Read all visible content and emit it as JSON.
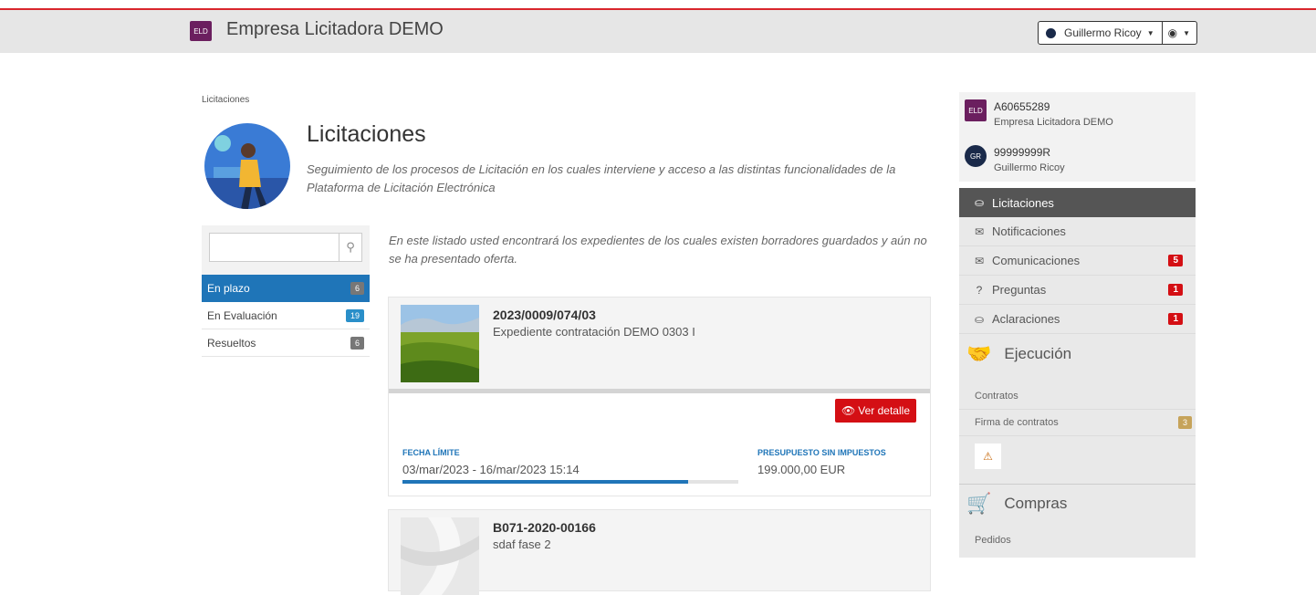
{
  "header": {
    "brand_badge": "ELD",
    "brand_name": "Empresa Licitadora DEMO",
    "user_name": "Guillermo Ricoy"
  },
  "breadcrumb": "Licitaciones",
  "page": {
    "title": "Licitaciones",
    "description": "Seguimiento de los procesos de Licitación en los cuales interviene y acceso a las distintas funcionalidades de la Plataforma de Licitación Electrónica"
  },
  "leftnav": {
    "search_placeholder": "",
    "items": [
      {
        "label": "En plazo",
        "count": "6"
      },
      {
        "label": "En Evaluación",
        "count": "19"
      },
      {
        "label": "Resueltos",
        "count": "6"
      }
    ]
  },
  "intro": "En este listado usted encontrará los expedientes de los cuales existen borradores guardados y aún no se ha presentado oferta.",
  "cards": [
    {
      "code": "2023/0009/074/03",
      "name": "Expediente contratación DEMO 0303 I",
      "detail_button": "Ver detalle",
      "deadline_label": "FECHA LÍMITE",
      "deadline_value": "03/mar/2023 - 16/mar/2023 15:14",
      "deadline_progress": 0.85,
      "budget_label": "PRESUPUESTO SIN IMPUESTOS",
      "budget_value": "199.000,00 EUR"
    },
    {
      "code": "B071-2020-00166",
      "name": "sdaf fase 2"
    }
  ],
  "sidebar": {
    "company_badge": "ELD",
    "company_id": "A60655289",
    "company_name": "Empresa Licitadora DEMO",
    "user_badge": "GR",
    "user_id": "99999999R",
    "user_name": "Guillermo Ricoy",
    "menu": [
      {
        "label": "Licitaciones",
        "icon": "inbox-icon",
        "badge": ""
      },
      {
        "label": "Notificaciones",
        "icon": "envelope-icon",
        "badge": ""
      },
      {
        "label": "Comunicaciones",
        "icon": "envelope-icon",
        "badge": "5"
      },
      {
        "label": "Preguntas",
        "icon": "question-icon",
        "badge": "1"
      },
      {
        "label": "Aclaraciones",
        "icon": "inbox-icon",
        "badge": "1"
      }
    ],
    "ejecucion": {
      "title": "Ejecución",
      "items": [
        {
          "label": "Contratos",
          "badge": ""
        },
        {
          "label": "Firma de contratos",
          "badge": "3"
        }
      ]
    },
    "compras": {
      "title": "Compras",
      "items": [
        {
          "label": "Pedidos"
        }
      ]
    }
  }
}
